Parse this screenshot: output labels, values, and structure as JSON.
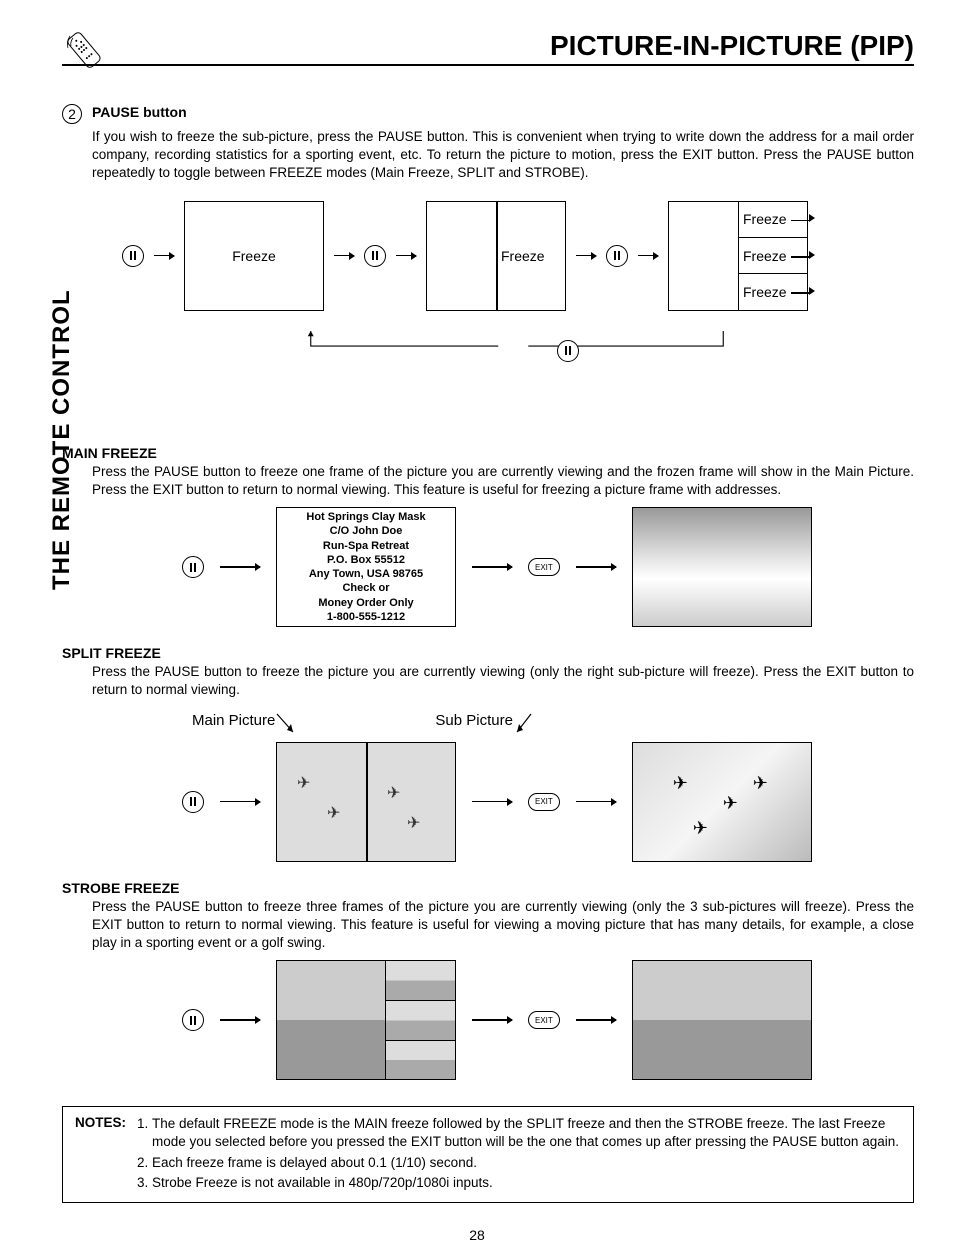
{
  "header": {
    "title": "PICTURE-IN-PICTURE (PIP)"
  },
  "side_label": "THE REMOTE CONTROL",
  "step": {
    "number": "2",
    "title": "PAUSE button",
    "body": "If you wish to freeze the sub-picture, press the PAUSE button. This is convenient when trying to write down the address for a mail order company, recording statistics for a sporting event, etc.  To return the picture to motion, press the EXIT button.  Press the PAUSE button repeatedly to toggle between FREEZE modes (Main Freeze, SPLIT and STROBE)."
  },
  "cycle": {
    "box1": "Freeze",
    "box2": "Freeze",
    "box3_r1": "Freeze",
    "box3_r2": "Freeze",
    "box3_r3": "Freeze"
  },
  "main_freeze": {
    "title": "MAIN FREEZE",
    "body": "Press the PAUSE button to freeze one frame of the picture you are currently viewing and the frozen frame will show in the Main Picture.  Press the EXIT button to return to normal viewing.  This feature is useful for freezing a picture frame with addresses.",
    "address": {
      "l1": "Hot Springs Clay Mask",
      "l2": "C/O John Doe",
      "l3": "Run-Spa Retreat",
      "l4": "P.O. Box 55512",
      "l5": "Any Town, USA 98765",
      "l6": "Check or",
      "l7": "Money Order Only",
      "l8": "1-800-555-1212"
    },
    "exit_label": "EXIT"
  },
  "split_freeze": {
    "title": "SPLIT FREEZE",
    "body": "Press the PAUSE button to freeze the picture you are currently viewing (only the right sub-picture will freeze).  Press the EXIT button to return to normal viewing.",
    "label_main": "Main Picture",
    "label_sub": "Sub Picture",
    "exit_label": "EXIT"
  },
  "strobe_freeze": {
    "title": "STROBE FREEZE",
    "body": "Press the PAUSE button to freeze three frames of the picture you are currently viewing (only the 3 sub-pictures will freeze). Press the EXIT button to return to normal viewing. This feature is useful for viewing a moving picture that has many details, for example, a close play in a sporting event or a golf swing.",
    "exit_label": "EXIT"
  },
  "notes": {
    "label": "NOTES:",
    "items": [
      "The default FREEZE mode is the MAIN freeze followed by the SPLIT freeze and then the STROBE freeze.  The last Freeze mode you selected before you pressed the EXIT button will be the one that comes up after pressing the PAUSE button again.",
      "Each freeze frame is delayed about 0.1 (1/10) second.",
      "Strobe Freeze is not available in 480p/720p/1080i inputs."
    ]
  },
  "page_number": "28"
}
